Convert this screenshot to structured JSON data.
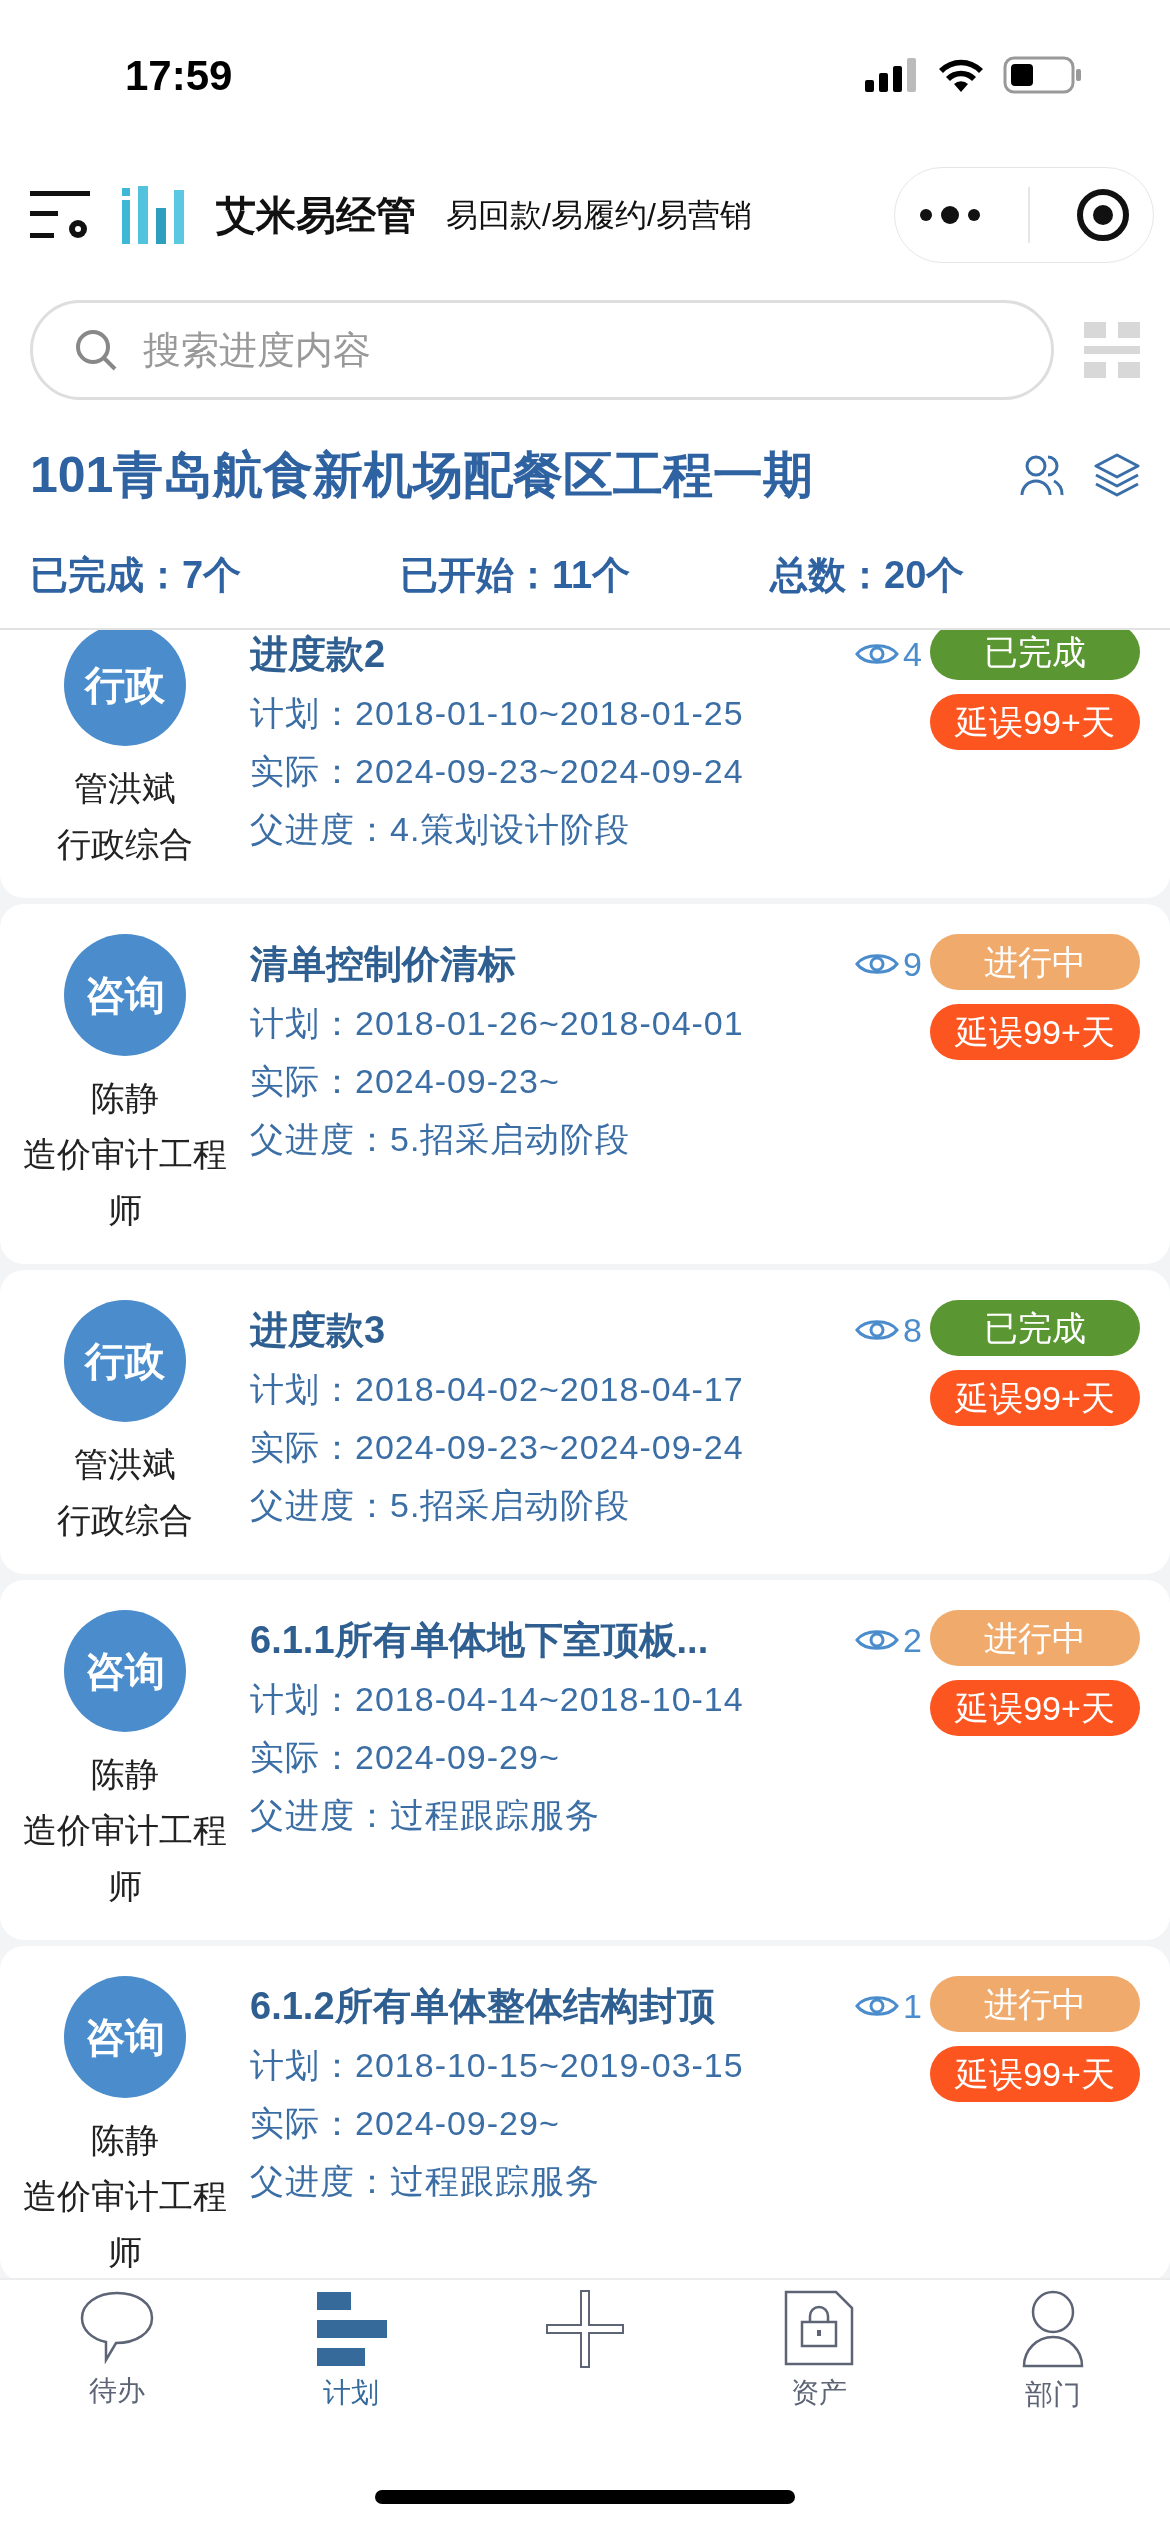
{
  "status_bar": {
    "time": "17:59"
  },
  "header": {
    "app_name": "艾米易经管",
    "slogan": "易回款/易履约/易营销"
  },
  "search": {
    "placeholder": "搜索进度内容"
  },
  "project": {
    "title": "101青岛航食新机场配餐区工程一期"
  },
  "stats": [
    "已完成：7个",
    "已开始：11个",
    "总数：20个"
  ],
  "cards": [
    {
      "category": "行政",
      "name": "管洪斌",
      "role": "行政综合",
      "title": "进度款2",
      "views": "4",
      "status": {
        "text": "已完成",
        "kind": "done"
      },
      "delay": "延误99+天",
      "lines": [
        "计划：2018-01-10~2018-01-25",
        "实际：2024-09-23~2024-09-24",
        "父进度：4.策划设计阶段"
      ]
    },
    {
      "category": "咨询",
      "name": "陈静",
      "role": "造价审计工程师",
      "title": "清单控制价清标",
      "views": "9",
      "status": {
        "text": "进行中",
        "kind": "progress"
      },
      "delay": "延误99+天",
      "lines": [
        "计划：2018-01-26~2018-04-01",
        "实际：2024-09-23~",
        "父进度：5.招采启动阶段"
      ]
    },
    {
      "category": "行政",
      "name": "管洪斌",
      "role": "行政综合",
      "title": "进度款3",
      "views": "8",
      "status": {
        "text": "已完成",
        "kind": "done"
      },
      "delay": "延误99+天",
      "lines": [
        "计划：2018-04-02~2018-04-17",
        "实际：2024-09-23~2024-09-24",
        "父进度：5.招采启动阶段"
      ]
    },
    {
      "category": "咨询",
      "name": "陈静",
      "role": "造价审计工程师",
      "title": "6.1.1所有单体地下室顶板...",
      "views": "2",
      "status": {
        "text": "进行中",
        "kind": "progress"
      },
      "delay": "延误99+天",
      "lines": [
        "计划：2018-04-14~2018-10-14",
        "实际：2024-09-29~",
        "父进度：过程跟踪服务"
      ]
    },
    {
      "category": "咨询",
      "name": "陈静",
      "role": "造价审计工程师",
      "title": "6.1.2所有单体整体结构封顶",
      "views": "1",
      "status": {
        "text": "进行中",
        "kind": "progress"
      },
      "delay": "延误99+天",
      "lines": [
        "计划：2018-10-15~2019-03-15",
        "实际：2024-09-29~",
        "父进度：过程跟踪服务"
      ]
    }
  ],
  "tab_bar": [
    {
      "kind": "chat",
      "label": "待办",
      "selected": false
    },
    {
      "kind": "plan",
      "label": "计划",
      "selected": true
    },
    {
      "kind": "add",
      "selected": false
    },
    {
      "kind": "asset",
      "label": "资产",
      "selected": false
    },
    {
      "kind": "person",
      "label": "部门",
      "selected": false
    }
  ]
}
